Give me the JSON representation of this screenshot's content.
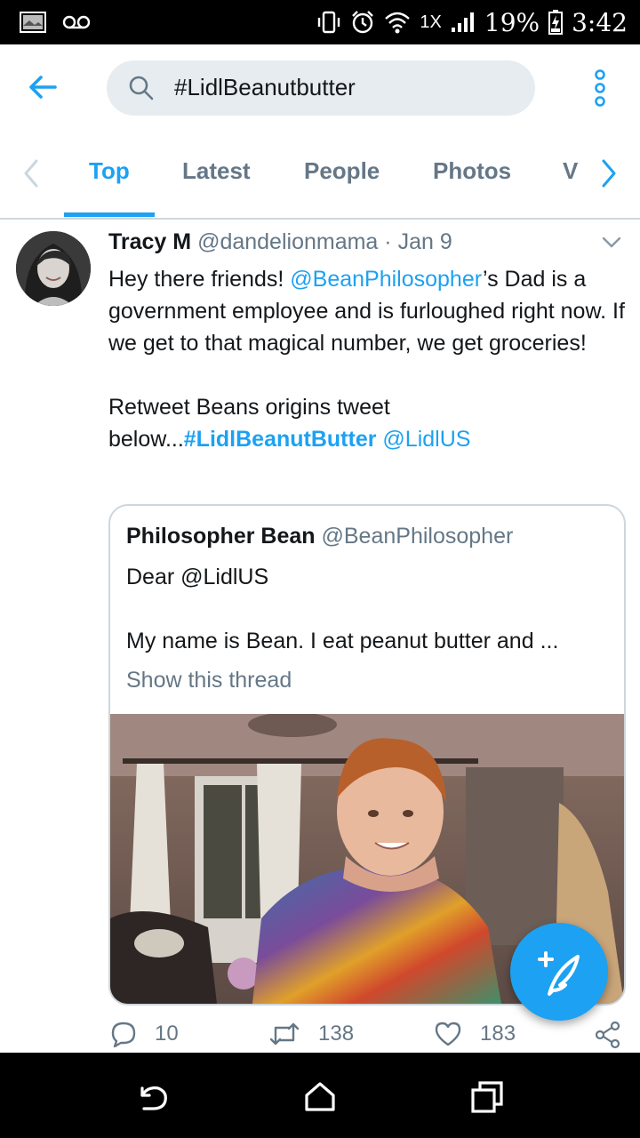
{
  "status_bar": {
    "speed": "1X",
    "battery": "19%",
    "time": "3:42"
  },
  "search": {
    "query": "#LidlBeanutbutter"
  },
  "tabs": [
    {
      "label": "Top"
    },
    {
      "label": "Latest"
    },
    {
      "label": "People"
    },
    {
      "label": "Photos"
    },
    {
      "label": "V"
    }
  ],
  "tweet": {
    "name": "Tracy M",
    "handle": "@dandelionmama",
    "separator": "·",
    "date": "Jan 9",
    "text_part1": "Hey there friends! ",
    "mention1": "@BeanPhilosopher",
    "text_part2": "’s Dad is a government employee and is furloughed right now. If we get to that magical number, we get groceries!",
    "text_part3": "Retweet Beans origins tweet below...",
    "hashtag": "#LidlBeanutButter",
    "mention2": "@LidlUS",
    "quoted": {
      "name": "Philosopher Bean",
      "handle": "@BeanPhilosopher",
      "line1": "Dear @LidlUS",
      "line2": "My name is Bean. I eat peanut butter and ...",
      "show_thread": "Show this thread"
    },
    "stats": {
      "replies": "10",
      "retweets": "138",
      "likes": "183"
    }
  },
  "colors": {
    "accent": "#1da1f2",
    "secondary_text": "#657786",
    "search_bg": "#e6ecf0"
  }
}
